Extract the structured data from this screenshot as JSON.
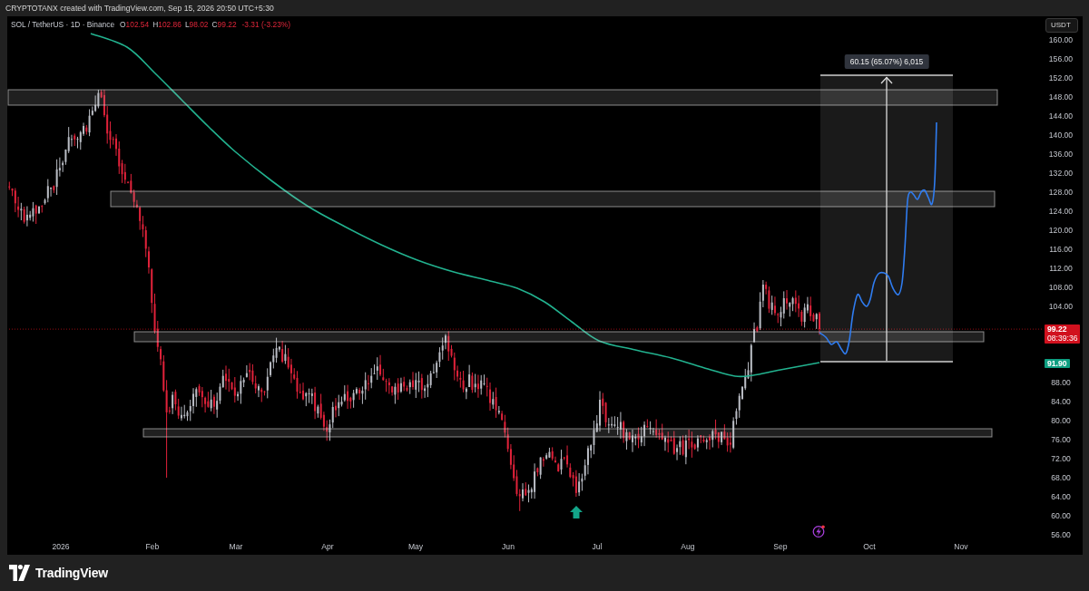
{
  "header": {
    "text": "CRYPTOTANX created with TradingView.com, Sep 15, 2026 20:50 UTC+5:30"
  },
  "legend": {
    "symbol": "SOL / TetherUS · 1D · Binance",
    "ohlc": [
      {
        "key": "O",
        "value": "102.54"
      },
      {
        "key": "H",
        "value": "102.86"
      },
      {
        "key": "L",
        "value": "98.02"
      },
      {
        "key": "C",
        "value": "99.22"
      }
    ],
    "change": "-3.31 (-3.23%)"
  },
  "price_axis": {
    "unit": "USDT",
    "labels": [
      "160.00",
      "156.00",
      "152.00",
      "148.00",
      "144.00",
      "140.00",
      "136.00",
      "132.00",
      "128.00",
      "124.00",
      "120.00",
      "116.00",
      "112.00",
      "108.00",
      "104.00",
      "88.00",
      "84.00",
      "80.00",
      "76.00",
      "72.00",
      "68.00",
      "64.00",
      "60.00",
      "56.00"
    ]
  },
  "price_tags": [
    {
      "kind": "last",
      "value": "99.22",
      "countdown": "08:39:36",
      "color": "#d1111e"
    },
    {
      "kind": "average",
      "value": "91.90",
      "color": "#0e9f81"
    }
  ],
  "measure": {
    "label": "60.15 (65.07%) 6,015"
  },
  "time_axis": {
    "labels": [
      "2026",
      "Feb",
      "Mar",
      "Apr",
      "May",
      "Jun",
      "Jul",
      "Aug",
      "Sep",
      "Oct",
      "Nov"
    ]
  },
  "footer": {
    "brand": "TradingView"
  }
}
